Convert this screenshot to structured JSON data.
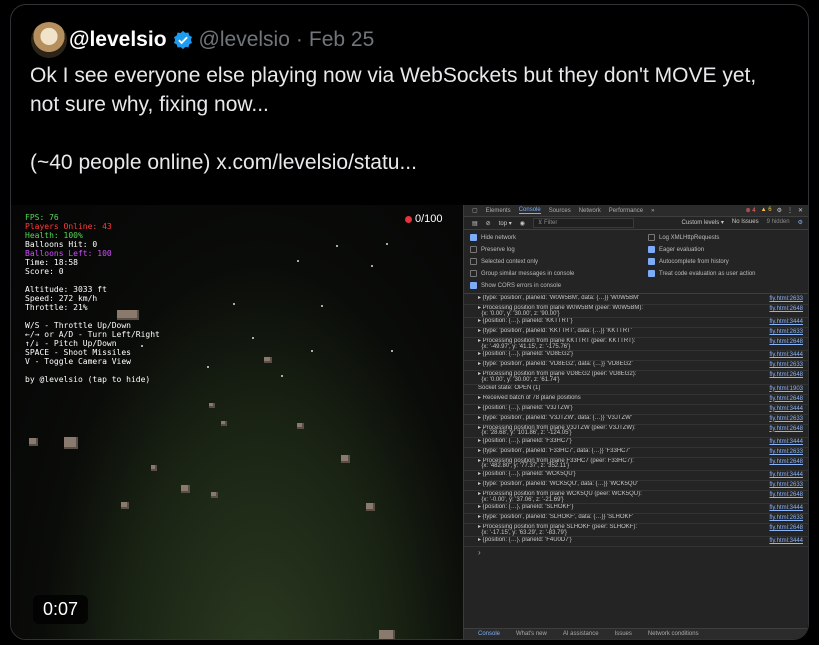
{
  "post": {
    "display_name": "@levelsio",
    "handle": "@levelsio",
    "separator": "·",
    "date": "Feb 25",
    "lines": [
      "Ok I see everyone else playing now via WebSockets but they don't MOVE yet,",
      "not sure why, fixing now..."
    ],
    "line3": "(~40 people online)  x.com/levelsio/statu..."
  },
  "game": {
    "players_count": "0/100",
    "timer": "0:07",
    "hud": {
      "fps": "FPS: 76",
      "players_online": "Players Online: 43",
      "health": "Health: 100%",
      "balloons_hit": "Balloons Hit: 0",
      "balloons_left": "Balloons Left: 100",
      "time": "Time: 18:58",
      "score": "Score: 0",
      "altitude": "Altitude: 3033 ft",
      "speed": "Speed: 272 km/h",
      "throttle": "Throttle: 21%",
      "c1": "W/S - Throttle Up/Down",
      "c2": "←/→ or A/D - Turn Left/Right",
      "c3": "↑/↓ - Pitch Up/Down",
      "c4": "SPACE - Shoot Missiles",
      "c5": "V - Toggle Camera View",
      "credit": "by @levelsio (tap to hide)"
    }
  },
  "devtools": {
    "tabs": [
      "Elements",
      "Console",
      "Sources",
      "Network",
      "Performance",
      "»"
    ],
    "errors": "4",
    "warnings": "6",
    "context": "top ▾",
    "filter_placeholder": "Filter",
    "levels": "Custom levels ▾",
    "issues": "No Issues",
    "hidden": "9 hidden",
    "settings": [
      {
        "label": "Hide network",
        "on": true
      },
      {
        "label": "Log XMLHttpRequests",
        "on": false
      },
      {
        "label": "Preserve log",
        "on": false
      },
      {
        "label": "Eager evaluation",
        "on": true
      },
      {
        "label": "Selected context only",
        "on": false
      },
      {
        "label": "Autocomplete from history",
        "on": true
      },
      {
        "label": "Group similar messages in console",
        "on": false
      },
      {
        "label": "Treat code evaluation as user action",
        "on": true
      },
      {
        "label": "Show CORS errors in console",
        "on": true
      }
    ],
    "log": [
      {
        "m": "▸ {type: 'position', planeId: 'W0W5BM', data: {…}} 'W0W5BM'",
        "s": "fly.html:2633"
      },
      {
        "m": "▸ Processing position from plane W0W5BM (peer: W0W5BM):\n  {x: '0.00', y: '30.00', z: '90.00'}",
        "s": "fly.html:2648"
      },
      {
        "m": "▸ {position: {…}, planeId: 'KKTTRT'}",
        "s": "fly.html:3444"
      },
      {
        "m": "▸ {type: 'position', planeId: 'KKTTRT', data: {…}} 'KKTTRT'",
        "s": "fly.html:2633"
      },
      {
        "m": "▸ Processing position from plane KKTTRT (peer: KKTTRT):\n  {x: '-49.97', y: '41.15', z: '-175.76'}",
        "s": "fly.html:2648"
      },
      {
        "m": "▸ {position: {…}, planeId: 'VD8EG2'}",
        "s": "fly.html:3444"
      },
      {
        "m": "▸ {type: 'position', planeId: 'VD8EG2', data: {…}} 'VD8EG2'",
        "s": "fly.html:2633"
      },
      {
        "m": "▸ Processing position from plane VD8EG2 (peer: VD8EG2):\n  {x: '0.00', y: '30.00', z: '61.74'}",
        "s": "fly.html:2648"
      },
      {
        "m": "Socket state: OPEN (1)",
        "s": "fly.html:1903"
      },
      {
        "m": "▸ Received batch of 78 plane positions",
        "s": "fly.html:2648"
      },
      {
        "m": "▸ {position: {…}, planeId: 'V3JTZW'}",
        "s": "fly.html:3444"
      },
      {
        "m": "▸ {type: 'position', planeId: 'V3JTZW', data: {…}} 'V3JTZW'",
        "s": "fly.html:2633"
      },
      {
        "m": "▸ Processing position from plane V3JTZW (peer: V3JTZW):\n  {x: '28.68', y: '101.86', z: '-124.05'}",
        "s": "fly.html:2648"
      },
      {
        "m": "▸ {position: {…}, planeId: 'F33HC7'}",
        "s": "fly.html:3444"
      },
      {
        "m": "▸ {type: 'position', planeId: 'F33HC7', data: {…}} 'F33HC7'",
        "s": "fly.html:2633"
      },
      {
        "m": "▸ Processing position from plane F33HC7 (peer: F33HC7):\n  {x: '482.80', y: '77.37', z: '352.11'}",
        "s": "fly.html:2648"
      },
      {
        "m": "▸ {position: {…}, planeId: 'WCK5QU'}",
        "s": "fly.html:3444"
      },
      {
        "m": "▸ {type: 'position', planeId: 'WCK5QU', data: {…}} 'WCK5QU'",
        "s": "fly.html:2633"
      },
      {
        "m": "▸ Processing position from plane WCK5QU (peer: WCK5QU):\n  {x: '-0.00', y: '37.06', z: '-21.69'}",
        "s": "fly.html:2648"
      },
      {
        "m": "▸ {position: {…}, planeId: 'SLHOKF'}",
        "s": "fly.html:3444"
      },
      {
        "m": "▸ {type: 'position', planeId: 'SLHOKF', data: {…}} 'SLHOKF'",
        "s": "fly.html:2633"
      },
      {
        "m": "▸ Processing position from plane SLHOKF (peer: SLHOKF):\n  {x: '-17.15', y: '63.29', z: '-83.79'}",
        "s": "fly.html:2648"
      },
      {
        "m": "▸ {position: {…}, planeId: 'F4U0D7'}",
        "s": "fly.html:3444"
      }
    ],
    "prompt": "›",
    "drawer": [
      "Console",
      "What's new",
      "AI assistance",
      "Issues",
      "Network conditions"
    ]
  },
  "colors": {
    "accent_blue": "#1d9bf0",
    "hud_green": "#57d657",
    "hud_red": "#ff3b3b",
    "hud_purple": "#d24dff"
  }
}
